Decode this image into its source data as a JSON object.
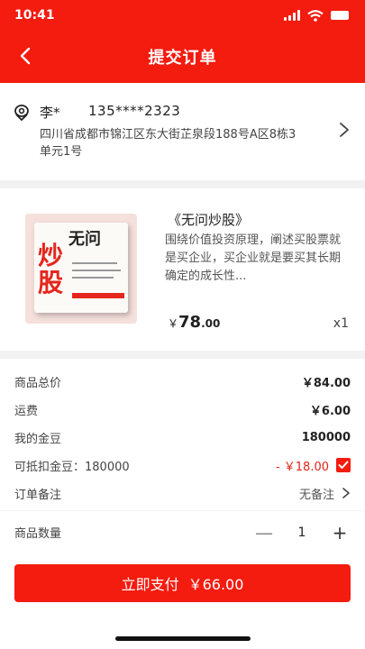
{
  "status_bar": {
    "time": "10:41"
  },
  "header": {
    "title": "提交订单"
  },
  "address": {
    "name": "李*",
    "phone": "135****2323",
    "street": "四川省成都市锦江区东大街芷泉段188号A区8栋3单元1号"
  },
  "product": {
    "title": "《无问炒股》",
    "description": "围绕价值投资原理，阐述买股票就是买企业，买企业就是要买其长期确定的成长性...",
    "price_currency": "￥",
    "price_int": "78",
    "price_dec": ".00",
    "quantity_label": "x1",
    "cover_text": {
      "line1": "无问",
      "line2": "炒",
      "line3": "股"
    }
  },
  "summary": {
    "rows": [
      {
        "label": "商品总价",
        "value": "￥84.00"
      },
      {
        "label": "运费",
        "value": "￥6.00"
      },
      {
        "label": "我的金豆",
        "value": "180000"
      },
      {
        "label": "可抵扣金豆：180000",
        "value": "- ￥18.00"
      },
      {
        "label": "订单备注",
        "value": "无备注"
      }
    ]
  },
  "quantity": {
    "label": "商品数量",
    "value": "1",
    "minus": "—",
    "plus": "+"
  },
  "pay": {
    "label": "立即支付",
    "amount": "￥66.00"
  },
  "colors": {
    "brand": "#f41b0f",
    "discount": "#e02418"
  }
}
